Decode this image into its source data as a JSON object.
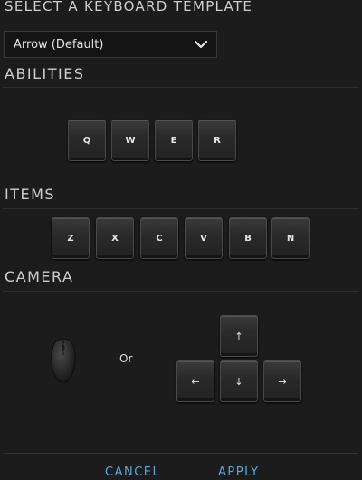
{
  "header": {
    "title": "SELECT A KEYBOARD TEMPLATE"
  },
  "template_select": {
    "value": "Arrow (Default)"
  },
  "sections": {
    "abilities": "ABILITIES",
    "items": "ITEMS",
    "camera": "CAMERA"
  },
  "ability_keys": [
    "Q",
    "W",
    "E",
    "R"
  ],
  "item_keys": [
    "Z",
    "X",
    "C",
    "V",
    "B",
    "N"
  ],
  "camera": {
    "or_label": "Or",
    "arrow_keys": {
      "up": "↑",
      "left": "←",
      "down": "↓",
      "right": "→"
    }
  },
  "footer": {
    "cancel_label": "CANCEL",
    "apply_label": "APPLY"
  },
  "colors": {
    "background": "#1c1c1c",
    "accent": "#5aa6d8",
    "key": "#2a2a2a"
  },
  "icons": {
    "dropdown": "chevron-down-icon",
    "mouse": "mouse-icon"
  }
}
